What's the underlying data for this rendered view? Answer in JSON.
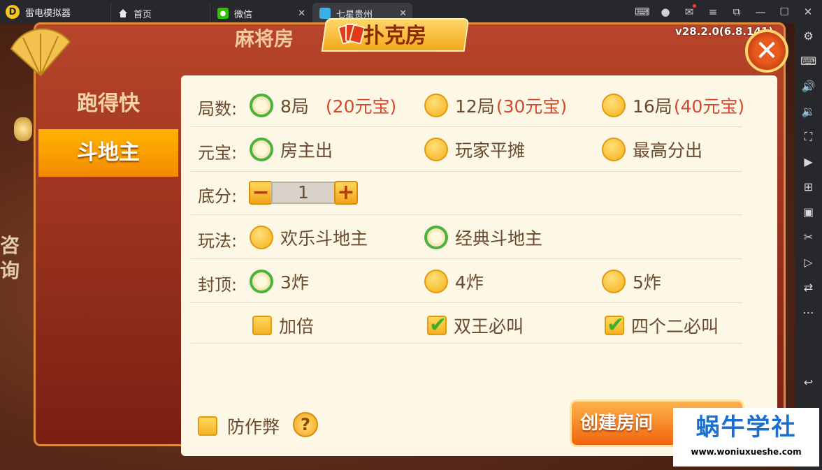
{
  "window": {
    "app_name": "雷电模拟器",
    "tabs": [
      {
        "label": "首页",
        "icon": "home-icon"
      },
      {
        "label": "微信",
        "icon": "wechat-icon"
      },
      {
        "label": "七星贵州",
        "icon": "game-icon",
        "active": true
      }
    ],
    "close_glyph": "✕"
  },
  "game": {
    "version": "v28.2.0(6.8.141)",
    "top_tabs": {
      "mahjong": "麻将房",
      "poker": "扑克房",
      "active": "poker"
    },
    "side_menu": [
      {
        "label": "跑得快",
        "active": false
      },
      {
        "label": "斗地主",
        "active": true
      }
    ],
    "bg_text": [
      "咨",
      "询"
    ],
    "rows": {
      "rounds": {
        "label": "局数:",
        "options": [
          {
            "text": "8局",
            "price": "(20元宝)",
            "selected": true
          },
          {
            "text": "12局",
            "price": "(30元宝)",
            "selected": false
          },
          {
            "text": "16局",
            "price": "(40元宝)",
            "selected": false
          }
        ]
      },
      "payment": {
        "label": "元宝:",
        "options": [
          {
            "text": "房主出",
            "selected": true
          },
          {
            "text": "玩家平摊",
            "selected": false
          },
          {
            "text": "最高分出",
            "selected": false
          }
        ]
      },
      "base_score": {
        "label": "底分:",
        "value": "1",
        "minus": "−",
        "plus": "+"
      },
      "mode": {
        "label": "玩法:",
        "options": [
          {
            "text": "欢乐斗地主",
            "selected": false
          },
          {
            "text": "经典斗地主",
            "selected": true
          }
        ]
      },
      "cap": {
        "label": "封顶:",
        "options": [
          {
            "text": "3炸",
            "selected": true
          },
          {
            "text": "4炸",
            "selected": false
          },
          {
            "text": "5炸",
            "selected": false
          }
        ]
      },
      "extras": [
        {
          "text": "加倍",
          "checked": false
        },
        {
          "text": "双王必叫",
          "checked": true
        },
        {
          "text": "四个二必叫",
          "checked": true
        }
      ]
    },
    "anti_cheat": {
      "text": "防作弊",
      "checked": false,
      "help": "?"
    },
    "create_button": "创建房间"
  },
  "watermark": {
    "title": "蜗牛学社",
    "url": "www.woniuxueshe.com"
  }
}
